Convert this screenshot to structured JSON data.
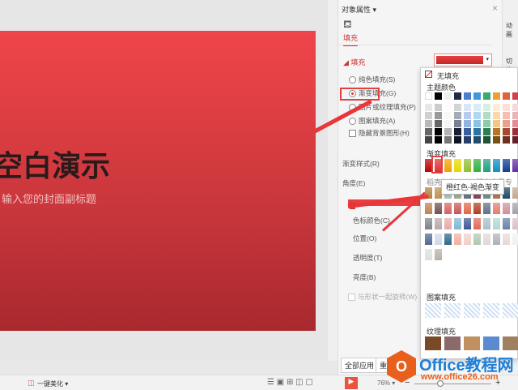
{
  "slide": {
    "title": "空白演示",
    "subtitle": "输入您的封面副标题"
  },
  "panel": {
    "title": "对象属性 ▾",
    "close": "×",
    "tab": "填充",
    "section": "◢ 填充",
    "options": [
      {
        "label": "纯色填充(S)",
        "checked": false
      },
      {
        "label": "渐变填充(G)",
        "checked": true
      },
      {
        "label": "图片或纹理填充(P)",
        "checked": false
      },
      {
        "label": "图案填充(A)",
        "checked": false
      }
    ],
    "hide_bg": "隐藏背景图形(H)",
    "fields": [
      "渐变样式(R)",
      "角度(E)",
      "色标颜色(C)",
      "位置(O)",
      "透明度(T)",
      "亮度(B)"
    ],
    "rotate": "与形状一起旋转(W)",
    "apply_all": "全部应用",
    "reset": "重置背景"
  },
  "right_strip": [
    "动画",
    "切换"
  ],
  "dropdown": {
    "no_fill": "无填充",
    "theme": "主题颜色",
    "gradient": "渐变填充",
    "recommend": "稻壳颜色",
    "member": "稻壳会员专享",
    "tooltip": "橙红色-褐色渐变",
    "pattern": "图案填充",
    "texture": "纹理填充",
    "theme_colors": [
      "#ffffff",
      "#000000",
      "#eeeeee",
      "#1f2a44",
      "#4a7fd0",
      "#3d9ad6",
      "#3aaa6a",
      "#f0a030",
      "#e06040",
      "#d04050"
    ],
    "gradient_colors": [
      "#c00000",
      "#e03030",
      "#f0a000",
      "#e8d800",
      "#90c030",
      "#30b040",
      "#20a080",
      "#1090c0",
      "#103c90",
      "#6030a0"
    ],
    "recommend_colors": [
      "#b08040",
      "#c09050",
      "#a8c0c0",
      "#a0a890",
      "#607080",
      "#804050",
      "#6a8a88",
      "#b87040",
      "#1a4a68",
      "#c0a890",
      "#c08050",
      "#705050",
      "#d86060",
      "#c85858",
      "#e06848",
      "#b04020",
      "#607088",
      "#e08070",
      "#d090a0",
      "#a0a0a8",
      "#808088",
      "#b8a8a8",
      "#e8a8a8",
      "#80b8d0",
      "#405890",
      "#e06858",
      "#a8c0c8",
      "#b0d8d0",
      "#6880a8",
      "#d8c0c8",
      "#506890",
      "#d0d8e8",
      "#306888",
      "#f0b0a0",
      "#f0d0c8",
      "#b0c8b0",
      "#e0d8d8",
      "#b0b0b8",
      "#e8d8d8",
      "#f0f0f0",
      "#d8e0e0",
      "#b8b0a8"
    ],
    "texture_colors": [
      "#7a4a28",
      "#8a6a6a",
      "#c09060",
      "#5a8ad0",
      "#a08060"
    ]
  },
  "status": {
    "beautify": "一键美化 ▾",
    "zoom": "76% ▾"
  },
  "watermark": {
    "brand": "Office教程网",
    "url": "www.office26.com"
  }
}
